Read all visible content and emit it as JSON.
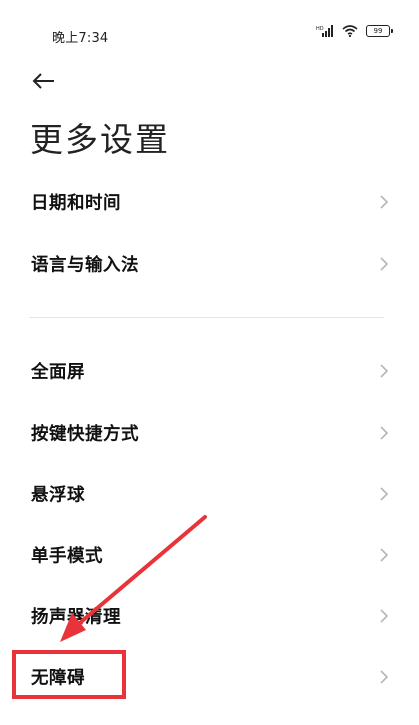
{
  "status_bar": {
    "time": "晚上7:34",
    "signal_label": "HD",
    "battery_level": "99"
  },
  "header": {
    "title": "更多设置"
  },
  "section1": {
    "items": [
      {
        "label": "日期和时间"
      },
      {
        "label": "语言与输入法"
      }
    ]
  },
  "section2": {
    "items": [
      {
        "label": "全面屏"
      },
      {
        "label": "按键快捷方式"
      },
      {
        "label": "悬浮球"
      },
      {
        "label": "单手模式"
      },
      {
        "label": "扬声器清理"
      },
      {
        "label": "无障碍"
      }
    ]
  },
  "colors": {
    "annotation": "#e8333a",
    "chevron": "#b5b5b5",
    "divider": "#e4e4e4"
  },
  "icons": {
    "back": "arrow-left",
    "chevron": "chevron-right",
    "signal": "cellular-signal",
    "wifi": "wifi",
    "battery": "battery"
  }
}
